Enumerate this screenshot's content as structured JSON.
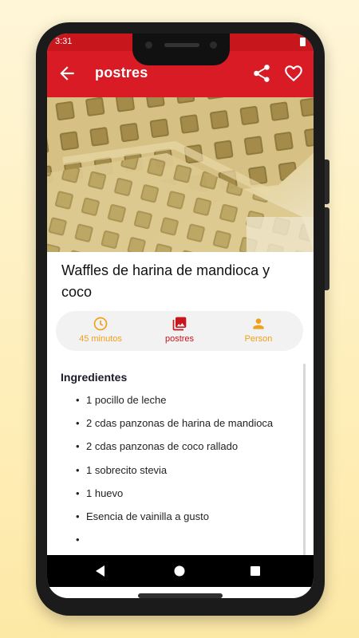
{
  "status_bar": {
    "time": "3:31"
  },
  "app_bar": {
    "title": "postres",
    "back_icon": "arrow-back-icon",
    "share_icon": "share-icon",
    "favorite_icon": "heart-outline-icon"
  },
  "recipe": {
    "image_alt": "waffles",
    "title": "Waffles de harina de mandioca y coco",
    "info": [
      {
        "icon": "clock-icon",
        "label": "45 minutos"
      },
      {
        "icon": "photo-gallery-icon",
        "label": "postres"
      },
      {
        "icon": "person-icon",
        "label": "Person"
      }
    ],
    "ingredients_title": "Ingredientes",
    "ingredients": [
      "1 pocillo de leche",
      "2 cdas panzonas de harina de mandioca",
      "2 cdas panzonas de coco rallado",
      "1 sobrecito stevia",
      "1 huevo",
      "Esencia de vainilla a gusto",
      ""
    ],
    "bullet": "•"
  },
  "navigation": {
    "back": "nav-back-icon",
    "home": "nav-home-icon",
    "recents": "nav-recents-icon"
  },
  "colors": {
    "primary": "#d81b24",
    "status_bar": "#c8161d",
    "accent": "#f0a01a",
    "background": "#fde9a6"
  }
}
